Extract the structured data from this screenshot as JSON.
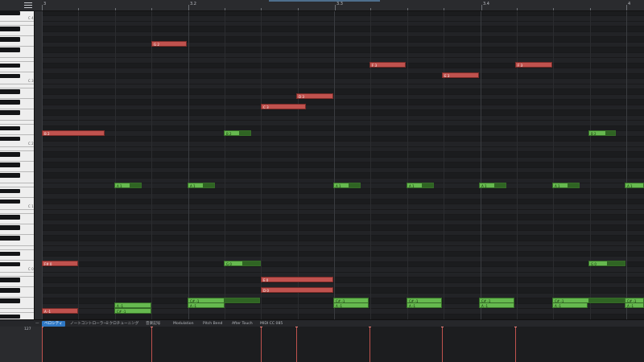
{
  "ruler": {
    "labels": [
      "3",
      "3.2",
      "3.3",
      "3.4",
      "4"
    ]
  },
  "keyboard": {
    "octave_labels": [
      "C 4",
      "C 3",
      "C 2",
      "C 1",
      "C 0"
    ]
  },
  "notes": [
    {
      "label": "G 2",
      "state": "selected"
    },
    {
      "label": "F 3",
      "state": "selected"
    },
    {
      "label": "E 3",
      "state": "selected"
    },
    {
      "label": "F 3",
      "state": "selected"
    },
    {
      "label": "D 3",
      "state": "selected"
    },
    {
      "label": "C 3",
      "state": "selected"
    },
    {
      "label": "B 2",
      "state": "selected"
    },
    {
      "label": "B 2",
      "state": "unselected"
    },
    {
      "label": "B 2",
      "state": "unselected"
    },
    {
      "label": "A 1",
      "state": "unselected"
    },
    {
      "label": "A 1",
      "state": "unselected"
    },
    {
      "label": "A 1",
      "state": "unselected"
    },
    {
      "label": "A 1",
      "state": "unselected"
    },
    {
      "label": "A 1",
      "state": "unselected"
    },
    {
      "label": "A 1",
      "state": "unselected"
    },
    {
      "label": "A 1",
      "state": "unselected"
    },
    {
      "label": "F# 0",
      "state": "selected"
    },
    {
      "label": "G 0",
      "state": "unselected"
    },
    {
      "label": "G 0",
      "state": "unselected"
    },
    {
      "label": "E 0",
      "state": "selected"
    },
    {
      "label": "D 0",
      "state": "selected"
    },
    {
      "label": "A -1",
      "state": "selected"
    },
    {
      "label": "A -1",
      "state": "unselected"
    },
    {
      "label": "C# -1",
      "state": "unselected"
    },
    {
      "label": "C# -1",
      "state": "unselected"
    },
    {
      "label": "A -1",
      "state": "unselected"
    },
    {
      "label": "C# -1",
      "state": "unselected"
    },
    {
      "label": "A -1",
      "state": "unselected"
    },
    {
      "label": "C# -1",
      "state": "unselected"
    },
    {
      "label": "A -1",
      "state": "unselected"
    },
    {
      "label": "C# -1",
      "state": "unselected"
    },
    {
      "label": "A -1",
      "state": "unselected"
    },
    {
      "label": "C# -1",
      "state": "unselected"
    },
    {
      "label": "A -1",
      "state": "unselected"
    },
    {
      "label": "C# -1",
      "state": "unselected"
    },
    {
      "label": "A -1",
      "state": "unselected"
    }
  ],
  "lanes": {
    "marker": "—",
    "tabs": [
      {
        "label": "ベロシティ",
        "active": true
      },
      {
        "label": "ノートコントローラー",
        "active": false
      },
      {
        "label": "ミクロチューニング",
        "active": false
      },
      {
        "label": "音楽記号",
        "active": false
      },
      {
        "label": "Modulation",
        "active": false
      },
      {
        "label": "Pitch Bend",
        "active": false
      },
      {
        "label": "After Touch",
        "active": false
      },
      {
        "label": "MIDI CC 085",
        "active": false
      }
    ],
    "max_value": "127",
    "velocities": [
      127,
      127,
      127,
      127,
      127,
      127,
      127
    ]
  },
  "colors": {
    "selected_note": "#c0524e",
    "unselected_note": "#66b94f",
    "active_tab": "#2f78c4"
  }
}
